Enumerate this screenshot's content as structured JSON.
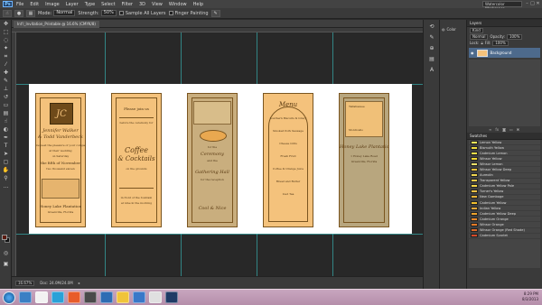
{
  "menubar": {
    "logo": "Ps",
    "items": [
      "File",
      "Edit",
      "Image",
      "Layer",
      "Type",
      "Select",
      "Filter",
      "3D",
      "View",
      "Window",
      "Help"
    ],
    "workspace": "Watercolor Workspace"
  },
  "options": {
    "mode_label": "Mode:",
    "mode_value": "Normal",
    "strength_label": "Strength:",
    "strength_value": "50%",
    "sample_all_label": "Sample All Layers",
    "finger_label": "Finger Painting"
  },
  "document": {
    "tab_label": "Int'l_Invitation_Printable @ 16.6% (CMYK/8)",
    "zoom": "16.67%",
    "doc_size": "Doc: 24.0M/24.0M"
  },
  "cards": {
    "c1": {
      "monogram": "JC",
      "l1": "Jennifer Walker",
      "l2": "& Todd Vanderbeck",
      "l3": "request the pleasure of your company",
      "l4": "at their wedding",
      "l5": "on Saturday",
      "l6": "the fifth of November",
      "l7": "two thousand eleven",
      "l8": "Honey Lake Plantation",
      "l9": "Greenville, Florida"
    },
    "c2": {
      "l1": "Please join us",
      "l2": "before the ceremony for",
      "l3": "Coffee",
      "l4": "& Cocktails",
      "l5": "on the grounds",
      "l6": "in front of the fountain",
      "l7": "at nine in the morning"
    },
    "c3": {
      "l1": "for the",
      "l2": "Ceremony",
      "l3": "and the",
      "l4": "Gathering Hall",
      "l5": "for the reception",
      "l6": "Cool & Nice"
    },
    "c4": {
      "title": "Menu",
      "l1": "Southern Biscuits & Gravy",
      "l2": "Smoked Pork Sausage",
      "l3": "Cheese Grits",
      "l4": "Fresh Fruit",
      "l5": "Coffee & Orange Juice",
      "l6": "Bread and Butter",
      "l7": "Iced Tea"
    },
    "c5": {
      "l1": "Tallahassee",
      "l2": "Monticello",
      "l3": "Honey Lake Plantation",
      "l4": "1 Honey Lake Road",
      "l5": "Greenville, Florida"
    }
  },
  "dock": {
    "icons": [
      "history-icon",
      "brush-presets-icon",
      "clone-source-icon",
      "layer-comps-icon",
      "character-icon"
    ],
    "mini_tabs": [
      "Color",
      "Swatches"
    ]
  },
  "layers_panel": {
    "title": "Layers",
    "kind_label": "Kind",
    "blend_mode": "Normal",
    "opacity_label": "Opacity:",
    "opacity_value": "100%",
    "lock_label": "Lock:",
    "fill_label": "Fill:",
    "fill_value": "100%",
    "layer_name": "Background"
  },
  "swatches_panel": {
    "title": "Swatches",
    "items": [
      {
        "name": "Lemon Yellow",
        "color": "#f7e85a"
      },
      {
        "name": "Bismuth Yellow",
        "color": "#f2dc3e"
      },
      {
        "name": "Cadmium Lemon",
        "color": "#f5e04a"
      },
      {
        "name": "Winsor Yellow",
        "color": "#f3d832"
      },
      {
        "name": "Winsor Lemon",
        "color": "#eee26a"
      },
      {
        "name": "Winsor Yellow Deep",
        "color": "#f0c23a"
      },
      {
        "name": "Aureolin",
        "color": "#f1d650"
      },
      {
        "name": "Transparent Yellow",
        "color": "#e9c84a"
      },
      {
        "name": "Cadmium Yellow Pale",
        "color": "#f5d548"
      },
      {
        "name": "Turner's Yellow",
        "color": "#ecc043"
      },
      {
        "name": "New Gamboge",
        "color": "#eab53a"
      },
      {
        "name": "Cadmium Yellow",
        "color": "#f1c02e"
      },
      {
        "name": "Indian Yellow",
        "color": "#e6a83a"
      },
      {
        "name": "Cadmium Yellow Deep",
        "color": "#eda42c"
      },
      {
        "name": "Cadmium Orange",
        "color": "#e98a2a"
      },
      {
        "name": "Winsor Orange",
        "color": "#e57a26"
      },
      {
        "name": "Winsor Orange (Red Shade)",
        "color": "#de6a28"
      },
      {
        "name": "Cadmium Scarlet",
        "color": "#d44a2a"
      }
    ]
  },
  "status": {
    "zoom": "16.67%",
    "doc": "Doc: 24.0M/24.0M"
  },
  "taskbar": {
    "time": "8:29 PM",
    "date": "8/3/2013",
    "apps": [
      "#3b7fc4",
      "#f2f2f2",
      "#2aa1d8",
      "#e85c2a",
      "#4a4a4a",
      "#2e6db4",
      "#f0c43a",
      "#3a78c8",
      "#e0e0e0",
      "#1f3b66"
    ]
  }
}
